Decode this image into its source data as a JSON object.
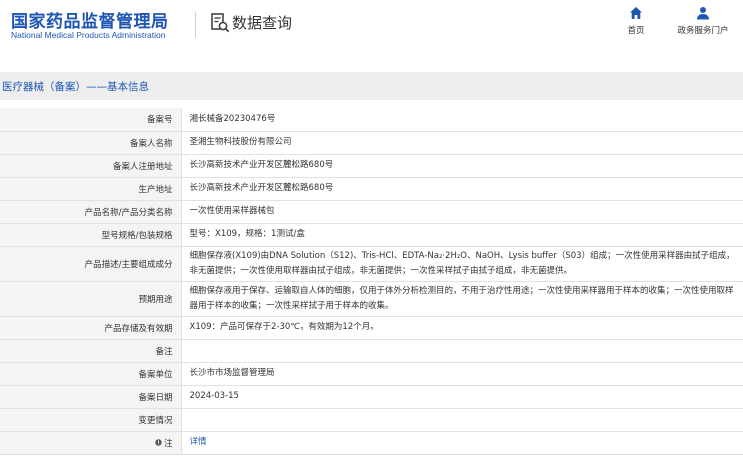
{
  "header": {
    "logo_cn": "国家药品监督管理局",
    "logo_en": "National Medical Products Administration",
    "query_title": "数据查询",
    "nav": {
      "home_label": "首页",
      "service_label": "政务服务门户"
    }
  },
  "section": {
    "title": "医疗器械（备案）——基本信息"
  },
  "fields": [
    {
      "label": "备案号",
      "value": "湘长械备20230476号"
    },
    {
      "label": "备案人名称",
      "value": "圣湘生物科技股份有限公司"
    },
    {
      "label": "备案人注册地址",
      "value": "长沙高新技术产业开发区麓松路680号"
    },
    {
      "label": "生产地址",
      "value": "长沙高新技术产业开发区麓松路680号"
    },
    {
      "label": "产品名称/产品分类名称",
      "value": "一次性使用采样器械包"
    },
    {
      "label": "型号规格/包装规格",
      "value": "型号：X109，规格：1测试/盒"
    },
    {
      "label": "产品描述/主要组成成分",
      "value": "细胞保存液(X109)由DNA Solution（S12)、Tris-HCl、EDTA-Na₂·2H₂O、NaOH、Lysis buffer（S03）组成；一次性使用采样器由拭子组成，非无菌提供；一次性使用取样器由拭子组成，非无菌提供；一次性采样拭子由拭子组成，非无菌提供。"
    },
    {
      "label": "预期用途",
      "value": "细胞保存液用于保存、运输取自人体的细胞，仅用于体外分析检测目的，不用于治疗性用途；一次性使用采样器用于样本的收集；一次性使用取样器用于样本的收集；一次性采样拭子用于样本的收集。"
    },
    {
      "label": "产品存储及有效期",
      "value": "X109：产品可保存于2-30℃，有效期为12个月。"
    },
    {
      "label": "备注",
      "value": ""
    },
    {
      "label": "备案单位",
      "value": "长沙市市场监督管理局"
    },
    {
      "label": "备案日期",
      "value": "2024-03-15"
    },
    {
      "label": "变更情况",
      "value": ""
    },
    {
      "label": "注",
      "value": "详情"
    }
  ],
  "colors": {
    "brand_blue": "#1f56b3",
    "label_bg": "#f4f4f4",
    "section_bg": "#eeeeee"
  },
  "icons": {
    "home": "home-icon",
    "service": "user-icon",
    "query": "search-document-icon",
    "note": "note-icon"
  }
}
